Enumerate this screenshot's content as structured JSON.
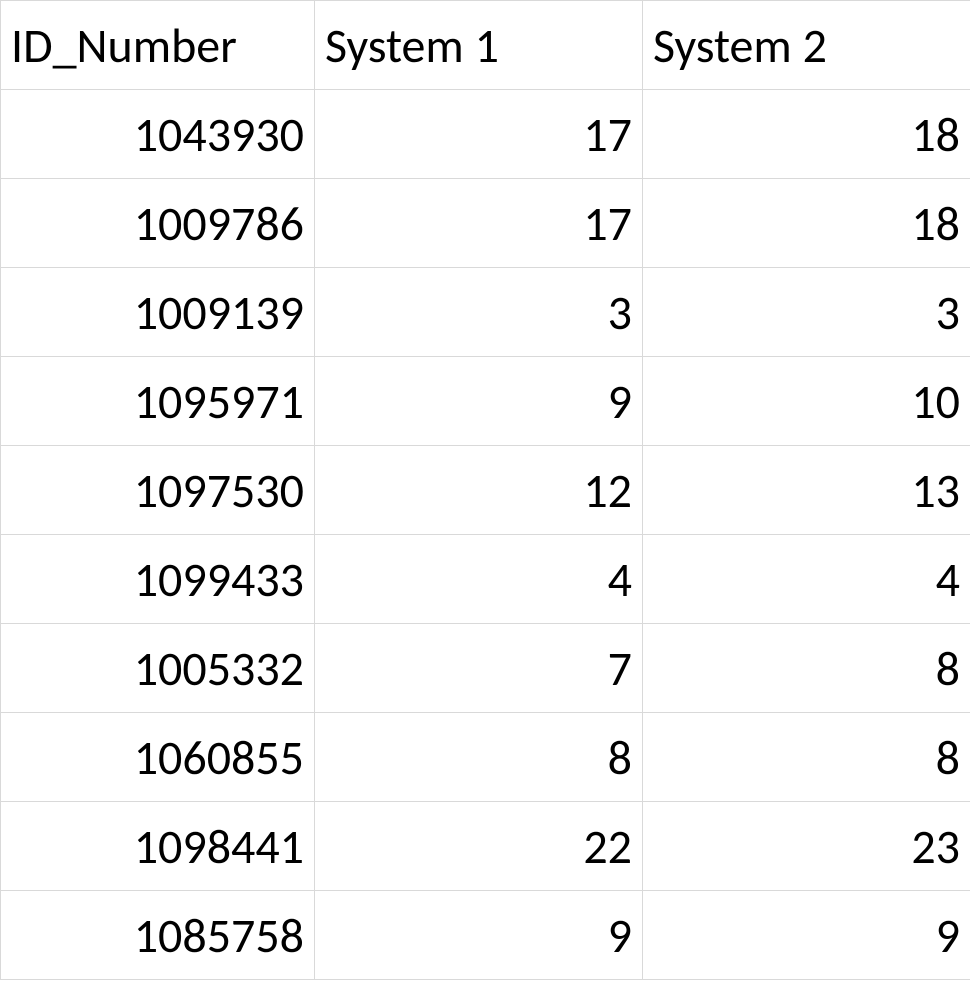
{
  "table": {
    "headers": [
      "ID_Number",
      "System 1",
      "System 2"
    ],
    "rows": [
      {
        "id": "1043930",
        "s1": "17",
        "s2": "18"
      },
      {
        "id": "1009786",
        "s1": "17",
        "s2": "18"
      },
      {
        "id": "1009139",
        "s1": "3",
        "s2": "3"
      },
      {
        "id": "1095971",
        "s1": "9",
        "s2": "10"
      },
      {
        "id": "1097530",
        "s1": "12",
        "s2": "13"
      },
      {
        "id": "1099433",
        "s1": "4",
        "s2": "4"
      },
      {
        "id": "1005332",
        "s1": "7",
        "s2": "8"
      },
      {
        "id": "1060855",
        "s1": "8",
        "s2": "8"
      },
      {
        "id": "1098441",
        "s1": "22",
        "s2": "23"
      },
      {
        "id": "1085758",
        "s1": "9",
        "s2": "9"
      }
    ]
  }
}
